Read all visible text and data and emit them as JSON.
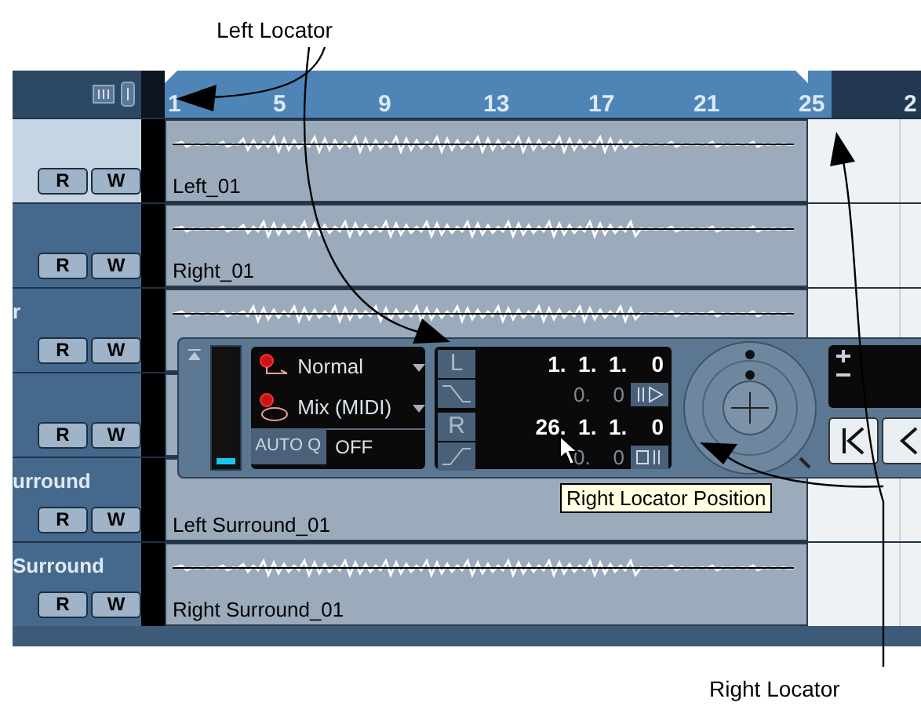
{
  "annotations": [
    {
      "text": "Left Locator"
    },
    {
      "text": "Right Locator"
    }
  ],
  "ruler": {
    "marks": [
      "1",
      "5",
      "9",
      "13",
      "17",
      "21",
      "25",
      "2"
    ]
  },
  "tracks": [
    {
      "selected": true,
      "buttons": [
        "R",
        "W"
      ],
      "event": "Left_01"
    },
    {
      "selected": false,
      "buttons": [
        "R",
        "W"
      ],
      "event": "Right_01"
    },
    {
      "name": "r",
      "selected": false,
      "buttons": [
        "R",
        "W"
      ]
    },
    {
      "selected": false,
      "buttons": [
        "R",
        "W"
      ]
    },
    {
      "name": "urround",
      "selected": false,
      "buttons": [
        "R",
        "W"
      ],
      "event": "Left Surround_01"
    },
    {
      "name": "Surround",
      "selected": false,
      "buttons": [
        "R",
        "W"
      ],
      "event": "Right Surround_01"
    }
  ],
  "transport": {
    "level": 0.06,
    "mode": "Normal",
    "mix": "Mix (MIDI)",
    "autoq_label": "AUTO Q",
    "autoq_value": "OFF",
    "locators": [
      {
        "label": "L",
        "position": "1.  1.  1.    0",
        "offset": "0.    0"
      },
      {
        "label": "R",
        "position": "26.  1.  1.    0",
        "offset": "0.    0"
      }
    ]
  },
  "tooltip": "Right Locator Position"
}
